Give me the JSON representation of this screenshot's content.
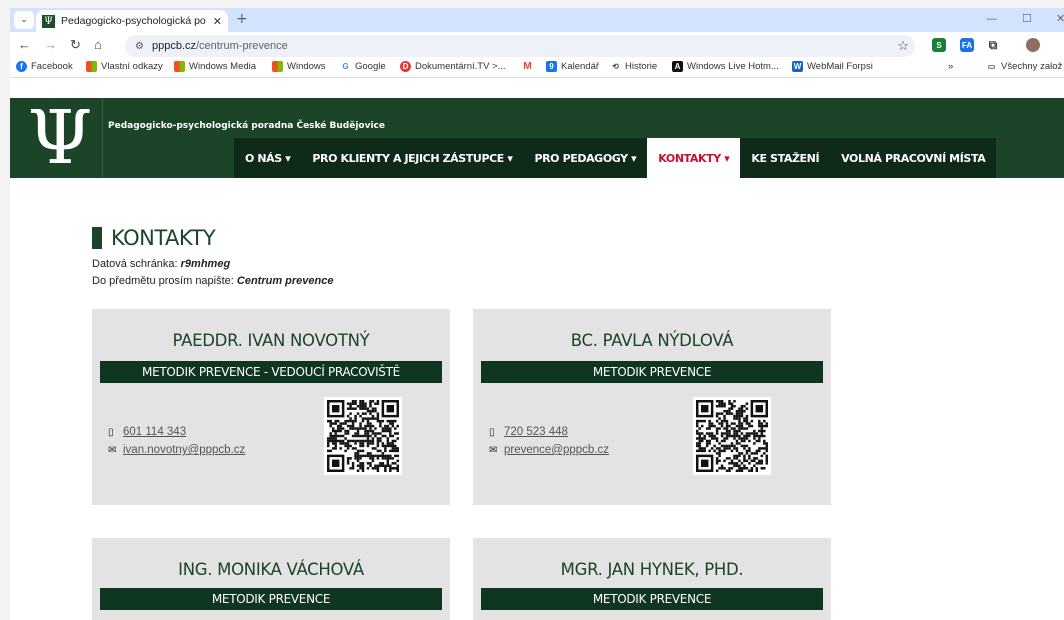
{
  "browser": {
    "tab_title": "Pedagogicko-psychologická po",
    "url_host": "pppcb.cz",
    "url_path": "/centrum-prevence",
    "bookmarks": [
      {
        "label": "Facebook",
        "icon": "facebook-icon",
        "color": "#1877f2"
      },
      {
        "label": "Vlastní odkazy",
        "icon": "windows-icon",
        "color": "#f25022"
      },
      {
        "label": "Windows Media",
        "icon": "windows-icon",
        "color": "#f25022"
      },
      {
        "label": "Windows",
        "icon": "windows-icon",
        "color": "#f25022"
      },
      {
        "label": "Google",
        "icon": "google-icon",
        "color": "#4285f4"
      },
      {
        "label": "Dokumentární.TV >...",
        "icon": "dokumentarni-icon",
        "color": "#e53935"
      },
      {
        "label": "",
        "icon": "gmail-icon",
        "color": "#ea4335"
      },
      {
        "label": "Kalendář",
        "icon": "calendar-icon",
        "color": "#1a73e8"
      },
      {
        "label": "Historie",
        "icon": "history-icon",
        "color": "#444444"
      },
      {
        "label": "Windows Live Hotm...",
        "icon": "a-icon",
        "color": "#111111"
      },
      {
        "label": "WebMail Forpsi",
        "icon": "webmail-icon",
        "color": "#1565c0"
      }
    ],
    "bookmarks_overflow": "»",
    "all_bookmarks": "Všechny založ"
  },
  "site": {
    "logo_glyph": "Ψ",
    "name": "Pedagogicko-psychologická poradna České Budějovice",
    "nav": [
      {
        "label": "O NÁS",
        "dropdown": true,
        "active": false
      },
      {
        "label": "PRO KLIENTY A JEJICH ZÁSTUPCE",
        "dropdown": true,
        "active": false
      },
      {
        "label": "PRO PEDAGOGY",
        "dropdown": true,
        "active": false
      },
      {
        "label": "KONTAKTY",
        "dropdown": true,
        "active": true
      },
      {
        "label": "KE STAŽENÍ",
        "dropdown": false,
        "active": false
      },
      {
        "label": "VOLNÁ PRACOVNÍ MÍSTA",
        "dropdown": false,
        "active": false
      }
    ],
    "brand_color": "#1b4429",
    "active_color": "#c8102e"
  },
  "page": {
    "title": "KONTAKTY",
    "databox_label": "Datová schránka: ",
    "databox_value": "r9mhmeg",
    "subject_label": "Do předmětu prosím napište: ",
    "subject_value": "Centrum prevence"
  },
  "contacts": [
    {
      "name": "PAEDDR. IVAN NOVOTNÝ",
      "role": "METODIK PREVENCE - VEDOUCÍ PRACOVIŠTĚ",
      "phone": "601 114 343",
      "email": "ivan.novotny@pppcb.cz"
    },
    {
      "name": "BC. PAVLA NÝDLOVÁ",
      "role": "METODIK PREVENCE",
      "phone": "720 523 448",
      "email": "prevence@pppcb.cz"
    },
    {
      "name": "ING. MONIKA VÁCHOVÁ",
      "role": "METODIK PREVENCE"
    },
    {
      "name": "MGR. JAN HYNEK, PHD.",
      "role": "METODIK PREVENCE"
    }
  ]
}
